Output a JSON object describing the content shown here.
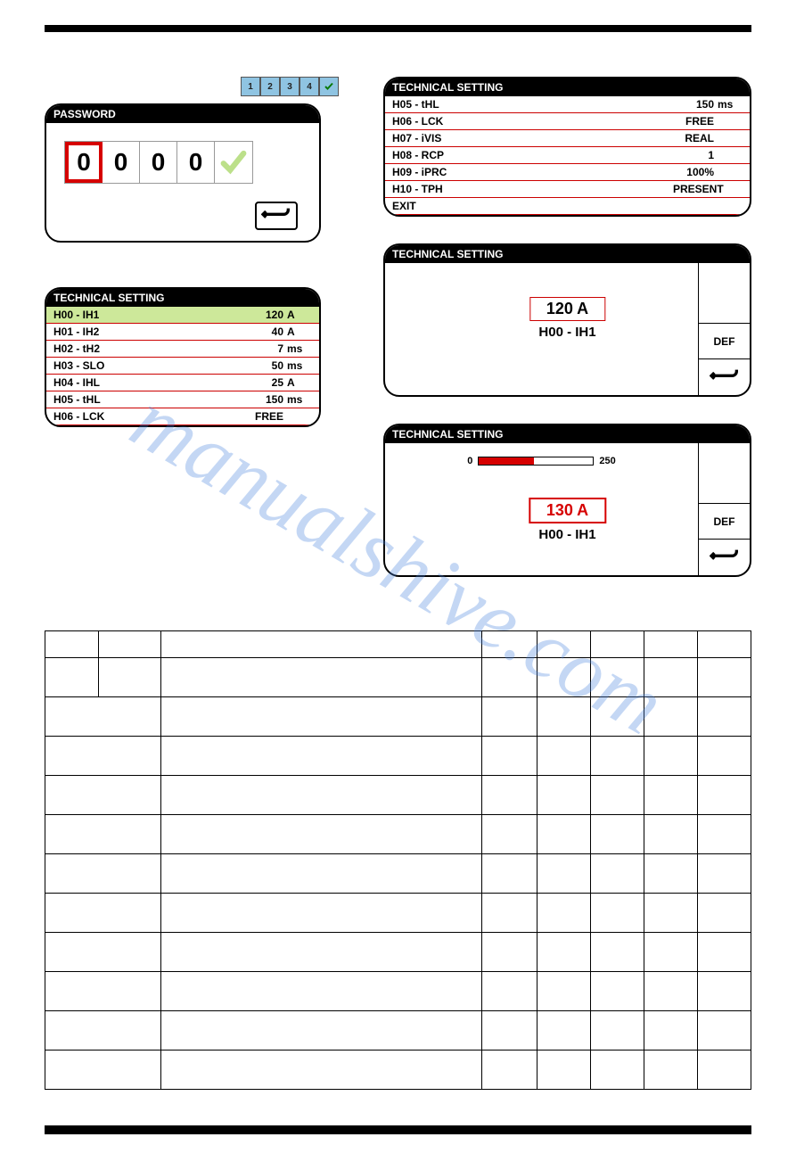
{
  "watermark": "manualshive.com",
  "segbar": {
    "cells": [
      "1",
      "2",
      "3",
      "4"
    ],
    "hasCheck": true
  },
  "password_panel": {
    "title": "PASSWORD",
    "digits": [
      "0",
      "0",
      "0",
      "0"
    ],
    "selected_index": 0
  },
  "tech_list_left": {
    "title": "TECHNICAL SETTING",
    "rows": [
      {
        "label": "H00 - IH1",
        "val": "120",
        "unit": "A",
        "hl": true
      },
      {
        "label": "H01 - IH2",
        "val": "40",
        "unit": "A"
      },
      {
        "label": "H02 - tH2",
        "val": "7",
        "unit": "ms"
      },
      {
        "label": "H03 - SLO",
        "val": "50",
        "unit": "ms"
      },
      {
        "label": "H04 - IHL",
        "val": "25",
        "unit": "A"
      },
      {
        "label": "H05 - tHL",
        "val": "150",
        "unit": "ms"
      },
      {
        "label": "H06 - LCK",
        "val": "FREE",
        "unit": ""
      }
    ]
  },
  "tech_list_right": {
    "title": "TECHNICAL SETTING",
    "rows": [
      {
        "label": "H05 - tHL",
        "val": "150",
        "unit": "ms"
      },
      {
        "label": "H06 - LCK",
        "val": "FREE",
        "unit": ""
      },
      {
        "label": "H07 - iVIS",
        "val": "REAL",
        "unit": ""
      },
      {
        "label": "H08 - RCP",
        "val": "1",
        "unit": ""
      },
      {
        "label": "H09 - iPRC",
        "val": "100%",
        "unit": ""
      },
      {
        "label": "H10 - TPH",
        "val": "PRESENT",
        "unit": ""
      },
      {
        "label": "EXIT",
        "val": "",
        "unit": ""
      }
    ]
  },
  "value_panel_1": {
    "title": "TECHNICAL SETTING",
    "value": "120  A",
    "param": "H00 - IH1",
    "def_label": "DEF"
  },
  "value_panel_2": {
    "title": "TECHNICAL SETTING",
    "slider_min": "0",
    "slider_max": "250",
    "value": "130  A",
    "param": "H00 - IH1",
    "def_label": "DEF"
  },
  "big_table": {
    "rows": 12,
    "cols_pattern": [
      [
        1,
        1,
        5,
        1,
        1,
        1,
        1,
        1
      ],
      [
        1,
        1,
        5,
        1,
        1,
        1,
        1,
        1
      ],
      [
        2,
        5,
        1,
        1,
        1,
        1,
        1
      ],
      [
        2,
        5,
        1,
        1,
        1,
        1,
        1
      ],
      [
        2,
        5,
        1,
        1,
        1,
        1,
        1
      ],
      [
        2,
        5,
        1,
        1,
        1,
        1,
        1
      ],
      [
        2,
        5,
        1,
        1,
        1,
        1,
        1
      ],
      [
        2,
        5,
        1,
        1,
        1,
        1,
        1
      ],
      [
        2,
        5,
        1,
        1,
        1,
        1,
        1
      ],
      [
        2,
        5,
        1,
        1,
        1,
        1,
        1
      ],
      [
        2,
        5,
        1,
        1,
        1,
        1,
        1
      ],
      [
        2,
        5,
        1,
        1,
        1,
        1,
        1
      ]
    ]
  }
}
